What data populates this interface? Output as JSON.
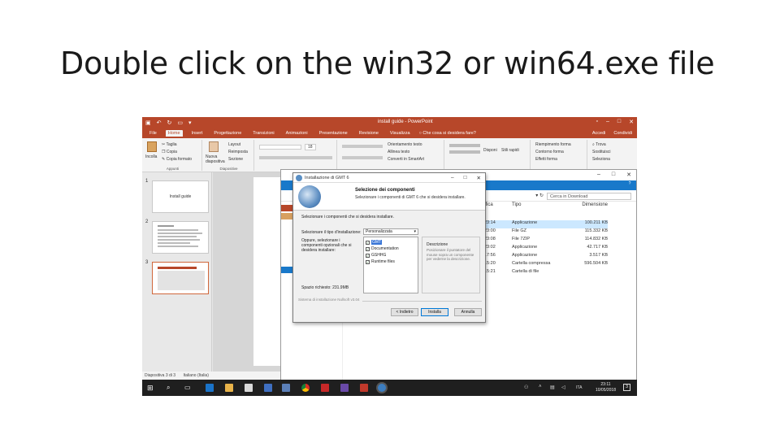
{
  "slide": {
    "title": "Double click on the win32 or win64.exe file"
  },
  "powerpoint": {
    "doc_title": "install guide - PowerPoint",
    "tabs": [
      "File",
      "Home",
      "Insert",
      "Progettazione",
      "Transizioni",
      "Animazioni",
      "Presentazione",
      "Revisione",
      "Visualizza"
    ],
    "active_tab": "Home",
    "search_hint": "Che cosa si desidera fare?",
    "account": "Accedi",
    "share": "Condividi",
    "ribbon": {
      "paste": "Incolla",
      "cut": "Taglia",
      "copy": "Copia",
      "format_painter": "Copia formato",
      "new_slide": "Nuova diapositiva",
      "layout": "Layout",
      "reset": "Reimposta",
      "section": "Sezione",
      "font_size": "18",
      "text_direction": "Orientamento testo",
      "align_text": "Allinea testo",
      "smartart": "Converti in SmartArt",
      "arrange": "Disponi",
      "quick_styles": "Stili rapidi",
      "shape_fill": "Riempimento forma",
      "shape_outline": "Contorno forma",
      "shape_effects": "Effetti forma",
      "find": "Trova",
      "replace": "Sostituisci",
      "select": "Seleziona",
      "group_clipboard": "Appunti",
      "group_slides": "Diapositive"
    },
    "thumbnails": [
      {
        "num": "1",
        "caption": "Install guide"
      },
      {
        "num": "2",
        "caption": ""
      },
      {
        "num": "3",
        "caption": ""
      }
    ],
    "status": [
      "Diapositiva 3 di 3",
      "Italiano (Italia)"
    ]
  },
  "explorer": {
    "search_placeholder": "Cerca in Download",
    "headers": {
      "date": "ifica",
      "type": "Tipo",
      "size": "Dimensione"
    },
    "rows": [
      {
        "date": "23:14",
        "type": "Applicazione",
        "size": "100.211 KB",
        "selected": true
      },
      {
        "date": "23:00",
        "type": "File GZ",
        "size": "115.332 KB",
        "selected": false
      },
      {
        "date": "23:08",
        "type": "File 7ZIP",
        "size": "114.832 KB",
        "selected": false
      },
      {
        "date": "23:02",
        "type": "Applicazione",
        "size": "42.717 KB",
        "selected": false
      },
      {
        "date": "17:56",
        "type": "Applicazione",
        "size": "3.517 KB",
        "selected": false
      },
      {
        "date": "15:20",
        "type": "Cartella compressa",
        "size": "596.504 KB",
        "selected": false
      },
      {
        "date": "15:21",
        "type": "Cartella di file",
        "size": "",
        "selected": false
      }
    ]
  },
  "installer": {
    "window_title": "Installazione di GMT 6",
    "header_title": "Selezione dei componenti",
    "header_sub": "Selezionare i componenti di GMT 6 che si desidera installare.",
    "desc": "Selezionare i componenti che si desidera installare.",
    "type_label": "Selezionare il tipo d'installazione:",
    "type_value": "Personalizzata",
    "choose_label": "Oppure, selezionare i componenti opzionali che si desidera installare:",
    "components": [
      "GMT",
      "Documentation",
      "GSHHG",
      "Runtime files"
    ],
    "description_title": "Descrizione",
    "description_text": "Posizionare il puntatore del mouse sopra un componente per vederne la descrizione.",
    "space_required": "Spazio richiesto: 231.9MB",
    "footer": "Sistema di installazione Nullsoft v3.04",
    "btn_back": "< Indietro",
    "btn_install": "Installa",
    "btn_cancel": "Annulla"
  },
  "taskbar": {
    "time": "23:11",
    "date": "10/05/2018",
    "lang": "ITA",
    "notifications": "3"
  },
  "colors": {
    "powerpoint_accent": "#b7472a",
    "explorer_ribbon": "#1979ca",
    "taskbar": "#1f1f1f"
  }
}
